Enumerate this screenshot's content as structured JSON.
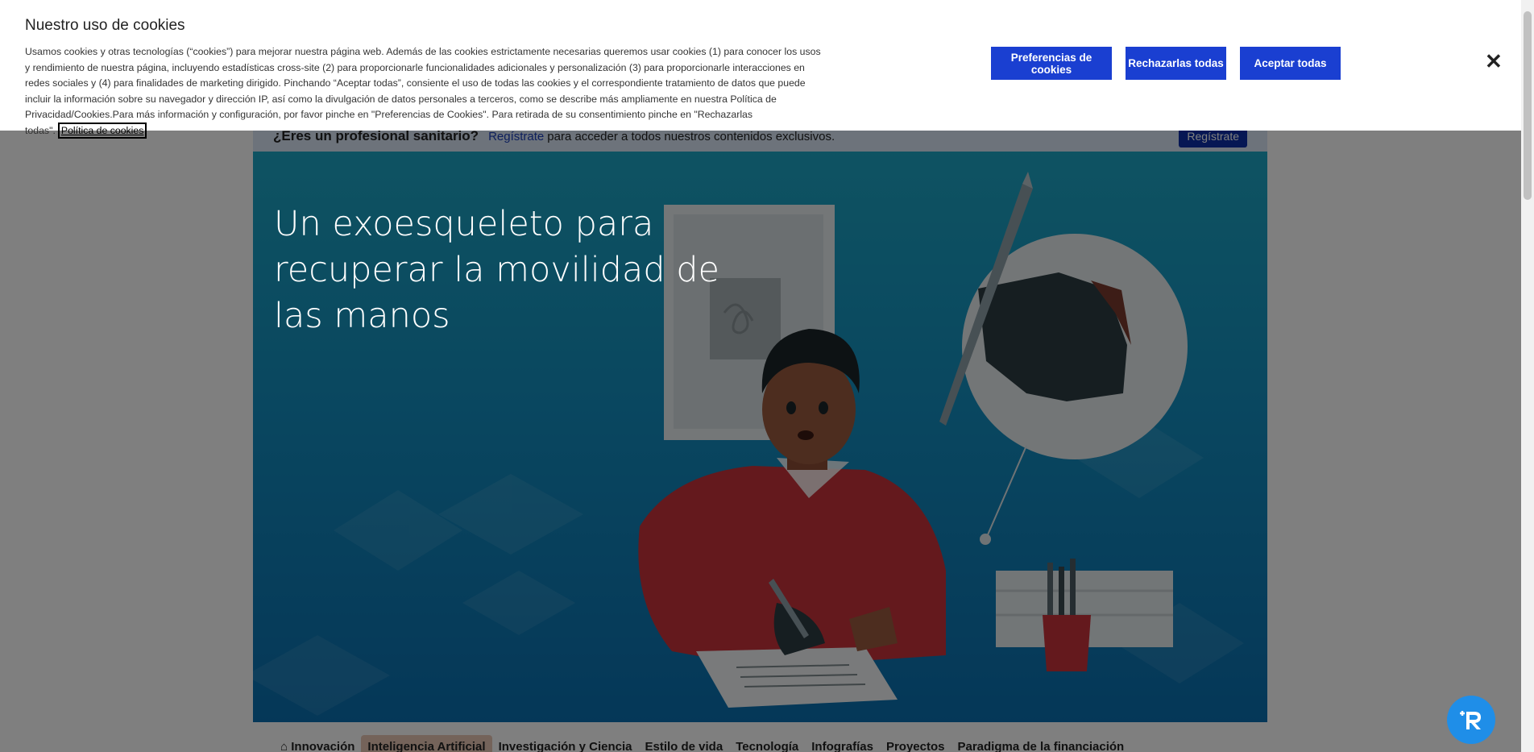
{
  "cookie_banner": {
    "title": "Nuestro uso de cookies",
    "text": "Usamos cookies y otras tecnologías (“cookies”) para mejorar nuestra página web. Además de las cookies estrictamente necesarias queremos usar cookies (1) para conocer los usos y rendimiento de nuestra página, incluyendo estadísticas cross-site (2) para proporcionarle funcionalidades adicionales y personalización (3) para proporcionarle interacciones en redes sociales y (4) para finalidades de marketing dirigido. Pinchando “Aceptar todas”, consiente el uso de todas las cookies y el correspondiente tratamiento de datos que puede incluir la información sobre su navegador y dirección IP, así como la divulgación de datos personales a terceros, como se describe más ampliamente en nuestra Política de Privacidad/Cookies.Para más información y configuración, por favor pinche en \"Preferencias de Cookies\". Para retirada de su consentimiento pinche en \"Rechazarlas todas\".",
    "policy_link": "Política de cookies",
    "preferences_label": "Preferencias de cookies",
    "reject_label": "Rechazarlas todas",
    "accept_label": "Aceptar todas",
    "close_icon": "close-icon"
  },
  "pro_banner": {
    "question": "¿Eres un profesional sanitario?",
    "link": "Regístrate",
    "text": "para acceder a todos nuestros contenidos exclusivos.",
    "button": "Regístrate"
  },
  "hero": {
    "title": "Un exoesqueleto para recuperar la movilidad de las manos"
  },
  "nav": {
    "items": [
      {
        "label": "Innovación",
        "icon": "home-icon"
      },
      {
        "label": "Inteligencia Artificial"
      },
      {
        "label": "Investigación y Ciencia"
      },
      {
        "label": "Estilo de vida"
      },
      {
        "label": "Tecnología"
      },
      {
        "label": "Infografías"
      },
      {
        "label": "Proyectos"
      },
      {
        "label": "Paradigma de la financiación"
      }
    ]
  },
  "colors": {
    "primary_button": "#1a3fd1",
    "hero_blue": "#138ec0",
    "shirt_red": "#c8323a"
  }
}
